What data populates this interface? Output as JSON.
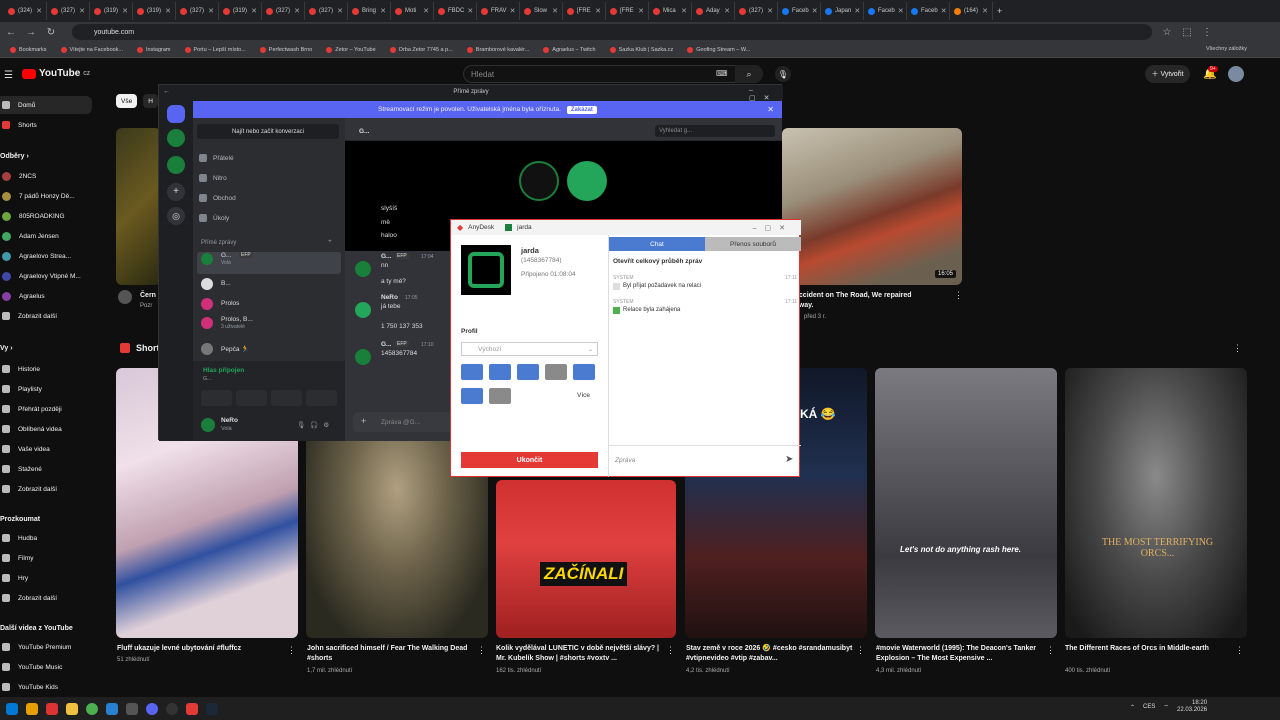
{
  "browser": {
    "tabs": [
      "(324)",
      "(327)",
      "(319)",
      "(319)",
      "(327)",
      "(319)",
      "(327)",
      "(327)",
      "Bring",
      "Moti",
      "FBDC",
      "FRAV",
      "Slow",
      "[FRE",
      "[FRE",
      "Mica",
      "Aday",
      "(327)",
      "Faceb",
      "Japan",
      "Faceb",
      "Faceb",
      "(164)"
    ],
    "url": "youtube.com",
    "bookmarks": [
      "Bookmarks",
      "Vítejte na Facebook...",
      "Instagram",
      "Portu – Lepší místo...",
      "Perfectwash Brno",
      "Zetor – YouTube",
      "Orba Zetor 7745 a p...",
      "Bramborové kavalér...",
      "Agraelus – Twitch",
      "Sazka Klub | Sazka.cz",
      "Goofing Stream – W..."
    ],
    "bookmarks_all": "Všechny záložky"
  },
  "youtube": {
    "logo": "YouTube",
    "logo_region": "CZ",
    "search_placeholder": "Hledat",
    "create_label": "Vytvořit",
    "notif_count": "9+",
    "chips": [
      "Vše",
      "H"
    ],
    "sidebar": {
      "home": "Domů",
      "shorts": "Shorts",
      "subs_head": "Odběry",
      "subs": [
        "2NCS",
        "7 pádů Honzy Dě...",
        "805ROADKING",
        "Adam Jensen",
        "Agraelovo Strea...",
        "Agraelovy Vtipné M...",
        "Agraelus",
        "Zobrazit další"
      ],
      "you_head": "Vy",
      "you": [
        "Historie",
        "Playlisty",
        "Přehrát později",
        "Oblíbená videa",
        "Vaše videa",
        "Stažené",
        "Zobrazit další"
      ],
      "explore_head": "Prozkoumat",
      "explore": [
        "Hudba",
        "Filmy",
        "Hry",
        "Zobrazit další"
      ],
      "more_head": "Další videa z YouTube",
      "more": [
        "YouTube Premium",
        "YouTube Music",
        "YouTube Kids"
      ]
    },
    "top_video": {
      "title_l1": "an Accident on The Road, We repaired",
      "title_l2": "ting way.",
      "meta": "před 3 r.",
      "duration": "16:05",
      "left_title_frag": "Čern",
      "left_meta_frag": "Pozr"
    },
    "shorts_head": "Short",
    "shorts": [
      {
        "title": "Fluff ukazuje levné ubytování #fluffcz",
        "meta": "51 zhlédnutí"
      },
      {
        "title": "John sacrificed himself / Fear The Walking Dead #shorts",
        "meta": "1,7 mil. zhlédnutí"
      },
      {
        "title": "Kolik vydělával LUNETIC v době největší slávy? | Mr. Kubelík Show | #shorts #voxtv ...",
        "meta": "162 tis. zhlédnutí",
        "overlay": "ZAČÍNALI"
      },
      {
        "title": "Stav země v roce 2026 🤣 #cesko #srandamusibyt #vtipnevideo #vtip #zabav...",
        "meta": "4,2 tis. zhlédnutí"
      },
      {
        "title": "#movie Waterworld (1995): The Deacon's Tanker Explosion – The Most Expensive ...",
        "meta": "4,3 mil. zhlédnutí",
        "overlay": "Let's not do anything rash here."
      },
      {
        "title": "The Different Races of Orcs in Middle-earth",
        "meta": "400 tis. zhlédnutí",
        "overlay": "THE MOST TERRIFYING ORCS..."
      }
    ],
    "shorts_overlay_ka": "KÁ 😂"
  },
  "discord": {
    "window_title": "Přímé zprávy",
    "banner_text": "Streamovací režim je povolen. Uživatelská jména byla oříznuta.",
    "banner_button": "Zakázat",
    "find_conv": "Najít nebo začít konverzaci",
    "nav": [
      "Přátelé",
      "Nitro",
      "Obchod",
      "Úkoly"
    ],
    "dm_head": "Přímé zprávy",
    "dms": [
      {
        "name": "G...",
        "tag": "EFP",
        "sub": "Volá"
      },
      {
        "name": "B...",
        "sub": ""
      },
      {
        "name": "Prolos",
        "sub": ""
      },
      {
        "name": "Prolos, B...",
        "sub": "3 uživatelé"
      },
      {
        "name": "Pepča 🏃",
        "sub": ""
      }
    ],
    "voice_status": "Hlas připojen",
    "voice_sub": "G...",
    "user_name": "NeRo",
    "user_status": "Volá",
    "header_name": "G...",
    "search_placeholder": "Vyhledat g...",
    "messages": [
      {
        "text": "slyšíš"
      },
      {
        "text": "mě"
      },
      {
        "text": "haloo"
      },
      {
        "author": "G...",
        "tag": "EFP",
        "time": "17:04",
        "text": "nn"
      },
      {
        "text": "a ty mě?"
      },
      {
        "author": "NeRo",
        "time": "17:05",
        "text": "já tebe"
      },
      {
        "text": "1 750 137 353"
      },
      {
        "author": "G...",
        "tag": "EFP",
        "time": "17:10",
        "text": "1458367784"
      }
    ],
    "input_placeholder": "Zpráva @G..."
  },
  "anydesk": {
    "title": "AnyDesk",
    "session_tab": "jarda",
    "peer_name": "jarda",
    "peer_id": "(1458367784)",
    "connected": "Připojeno 01:08:04",
    "profile_label": "Profil",
    "profile_value": "Výchozí",
    "more": "Více",
    "end_button": "Ukončit",
    "tabs": [
      "Chat",
      "Přenos souborů"
    ],
    "open_log": "Otevřít celkový průběh zpráv",
    "log": [
      {
        "who": "SYSTEM",
        "time": "17:11",
        "text": "Byl přijat požadavek na relaci"
      },
      {
        "who": "SYSTEM",
        "time": "17:11",
        "text": "Relace byla zahájena"
      }
    ],
    "message_placeholder": "Zpráva"
  },
  "taskbar": {
    "lang": "CES",
    "time": "18:20",
    "date": "22.03.2026"
  }
}
